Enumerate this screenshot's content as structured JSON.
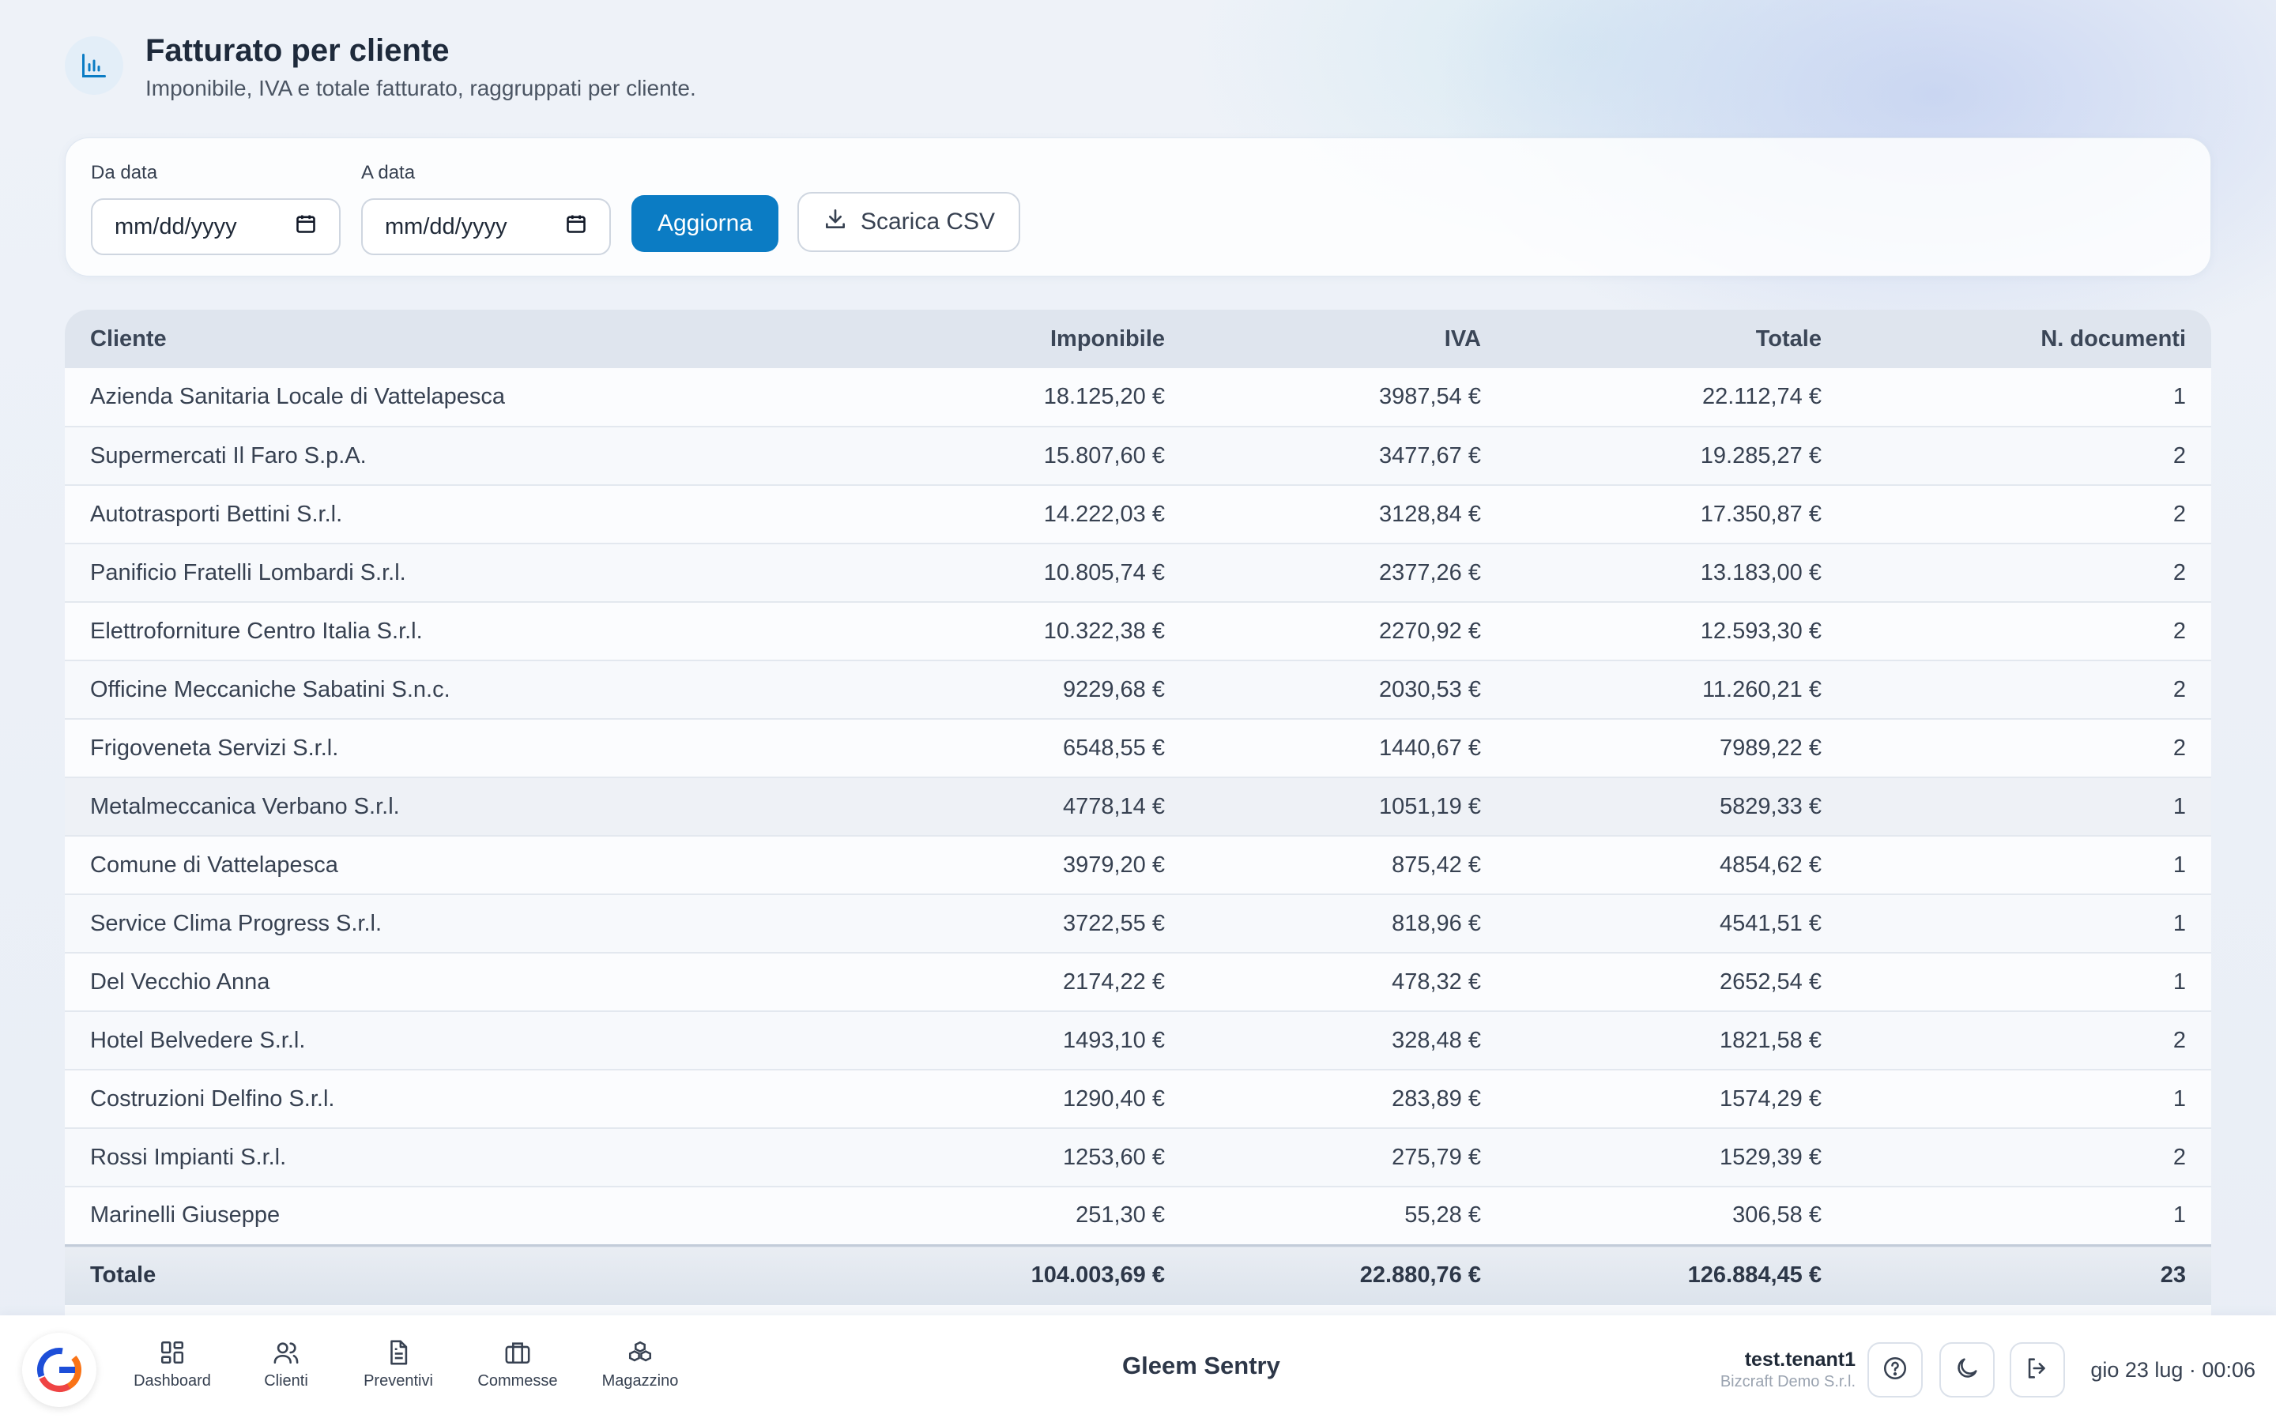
{
  "header": {
    "icon": "bar-chart-icon",
    "title": "Fatturato per cliente",
    "subtitle": "Imponibile, IVA e totale fatturato, raggruppati per cliente."
  },
  "filters": {
    "from_label": "Da data",
    "from_value": "mm/dd/yyyy",
    "to_label": "A data",
    "to_value": "mm/dd/yyyy",
    "refresh_label": "Aggiorna",
    "download_label": "Scarica CSV",
    "accent": "#0b7cc4"
  },
  "table": {
    "columns": [
      "Cliente",
      "Imponibile",
      "IVA",
      "Totale",
      "N. documenti"
    ],
    "rows": [
      [
        "Azienda Sanitaria Locale di Vattelapesca",
        "18.125,20 €",
        "3987,54 €",
        "22.112,74 €",
        "1"
      ],
      [
        "Supermercati Il Faro S.p.A.",
        "15.807,60 €",
        "3477,67 €",
        "19.285,27 €",
        "2"
      ],
      [
        "Autotrasporti Bettini S.r.l.",
        "14.222,03 €",
        "3128,84 €",
        "17.350,87 €",
        "2"
      ],
      [
        "Panificio Fratelli Lombardi S.r.l.",
        "10.805,74 €",
        "2377,26 €",
        "13.183,00 €",
        "2"
      ],
      [
        "Elettroforniture Centro Italia S.r.l.",
        "10.322,38 €",
        "2270,92 €",
        "12.593,30 €",
        "2"
      ],
      [
        "Officine Meccaniche Sabatini S.n.c.",
        "9229,68 €",
        "2030,53 €",
        "11.260,21 €",
        "2"
      ],
      [
        "Frigoveneta Servizi S.r.l.",
        "6548,55 €",
        "1440,67 €",
        "7989,22 €",
        "2"
      ],
      [
        "Metalmeccanica Verbano S.r.l.",
        "4778,14 €",
        "1051,19 €",
        "5829,33 €",
        "1"
      ],
      [
        "Comune di Vattelapesca",
        "3979,20 €",
        "875,42 €",
        "4854,62 €",
        "1"
      ],
      [
        "Service Clima Progress S.r.l.",
        "3722,55 €",
        "818,96 €",
        "4541,51 €",
        "1"
      ],
      [
        "Del Vecchio Anna",
        "2174,22 €",
        "478,32 €",
        "2652,54 €",
        "1"
      ],
      [
        "Hotel Belvedere S.r.l.",
        "1493,10 €",
        "328,48 €",
        "1821,58 €",
        "2"
      ],
      [
        "Costruzioni Delfino S.r.l.",
        "1290,40 €",
        "283,89 €",
        "1574,29 €",
        "1"
      ],
      [
        "Rossi Impianti S.r.l.",
        "1253,60 €",
        "275,79 €",
        "1529,39 €",
        "2"
      ],
      [
        "Marinelli Giuseppe",
        "251,30 €",
        "55,28 €",
        "306,58 €",
        "1"
      ]
    ],
    "highlighted_row": 7,
    "totals": [
      "Totale",
      "104.003,69 €",
      "22.880,76 €",
      "126.884,45 €",
      "23"
    ]
  },
  "bottom_bar": {
    "logo": "app-logo-icon",
    "nav": [
      {
        "label": "Dashboard",
        "icon": "dashboard-icon"
      },
      {
        "label": "Clienti",
        "icon": "users-icon"
      },
      {
        "label": "Preventivi",
        "icon": "document-icon"
      },
      {
        "label": "Commesse",
        "icon": "briefcase-icon"
      },
      {
        "label": "Magazzino",
        "icon": "boxes-icon"
      }
    ],
    "app_name": "Gleem Sentry",
    "user_name": "test.tenant1",
    "user_org": "Bizcraft Demo S.r.l.",
    "datetime": "gio 23 lug · 00:06"
  }
}
